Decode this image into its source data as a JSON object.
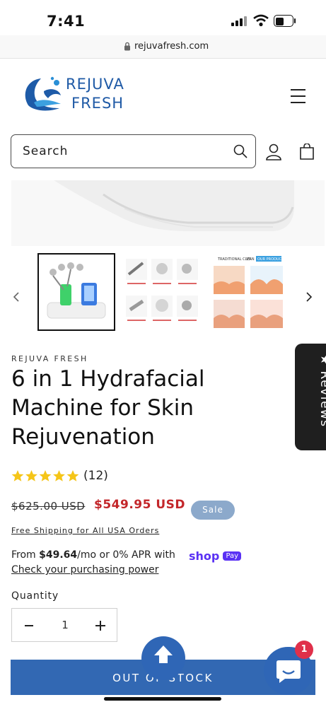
{
  "status_bar": {
    "time": "7:41"
  },
  "browser": {
    "url": "rejuvafresh.com"
  },
  "header": {
    "logo_line1": "REJUVA",
    "logo_line2": "FRESH",
    "search_label": "Search"
  },
  "product": {
    "vendor": "REJUVA FRESH",
    "title": "6 in 1 Hydrafacial Machine for Skin Rejuvenation",
    "rating_count": "(12)",
    "rating_stars": 5,
    "price_regular": "$625.00 USD",
    "price_sale": "$549.95 USD",
    "sale_badge": "Sale",
    "shipping_note": "Free Shipping for All USA Orders",
    "installment_prefix": "From ",
    "installment_amount": "$49.64",
    "installment_suffix": "/mo or 0% APR with",
    "shoppay_text": "shop",
    "shoppay_pay": "Pay",
    "check_power": "Check your purchasing power",
    "quantity_label": "Quantity",
    "quantity_value": "1",
    "oos_label": "OUT OF STOCK"
  },
  "thumb_text": {
    "compare_left": "TRADITIONAL CLEAN",
    "compare_vs": "VS",
    "compare_right": "OUR PRODUCT"
  },
  "widgets": {
    "reviews_label": "Reviews",
    "chat_badge": "1"
  },
  "colors": {
    "accent_blue": "#3268b3",
    "sale_red": "#c3262a",
    "badge_blue": "#8ca9cb",
    "shoppay_purple": "#5a31f4",
    "star_yellow": "#f5c518"
  }
}
